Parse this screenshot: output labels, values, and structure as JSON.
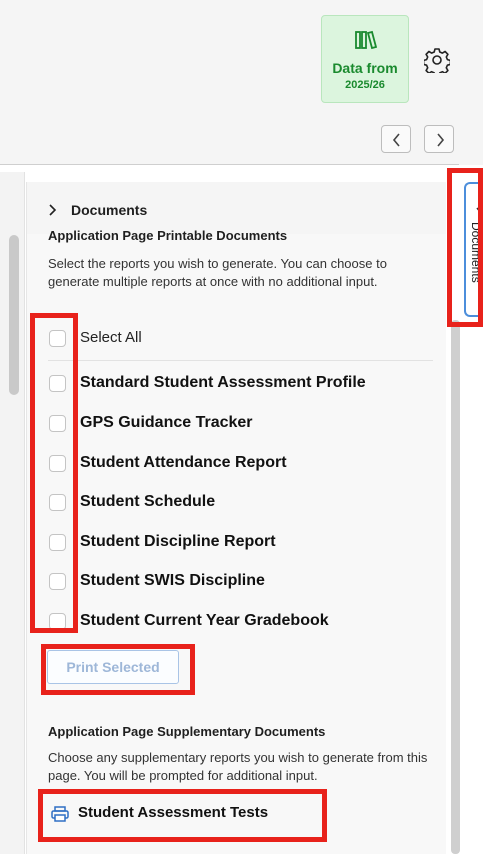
{
  "header": {
    "data_badge": {
      "line1": "Data from",
      "line2": "2025/26",
      "icon": "books-icon",
      "color": "#1a8a2e"
    },
    "settings_icon": "gear-icon",
    "nav": {
      "prev": "chevron-left-icon",
      "next": "chevron-right-icon"
    }
  },
  "panel": {
    "title": "Documents",
    "printable": {
      "title": "Application Page Printable Documents",
      "description": "Select the reports you wish to generate. You can choose to generate multiple reports at once with no additional input.",
      "select_all": "Select All",
      "items": [
        "Standard Student Assessment Profile",
        "GPS Guidance Tracker",
        "Student Attendance Report",
        "Student Schedule",
        "Student Discipline Report",
        "Student SWIS Discipline",
        "Student Current Year Gradebook"
      ],
      "print_button": "Print Selected"
    },
    "supplementary": {
      "title": "Application Page Supplementary Documents",
      "description": "Choose any supplementary reports you wish to generate from this page. You will be prompted for additional input.",
      "link": "Student Assessment Tests",
      "link_icon": "printer-icon"
    }
  },
  "side_tab": {
    "label": "Documents",
    "icon": "chevron-right-icon"
  },
  "colors": {
    "accent": "#4c8edb",
    "highlight": "#e8221b",
    "badge_bg": "#dcf5de"
  }
}
